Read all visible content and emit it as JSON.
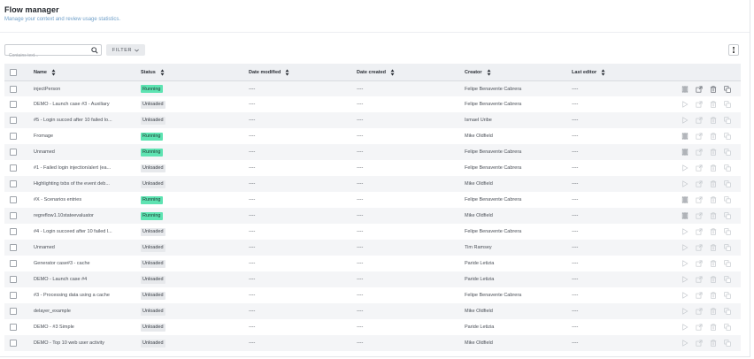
{
  "header": {
    "title": "Flow manager",
    "subtitle": "Manage your context and review usage statistics."
  },
  "toolbar": {
    "search_placeholder": "Contains text...",
    "filter_label": "FILTER"
  },
  "icons": {
    "search": "search-icon",
    "filter_chevron": "chevron-down-icon",
    "more": "more-vertical-icon",
    "sort": "sort-icon",
    "pause": "pause-icon",
    "play": "play-icon",
    "open": "open-external-icon",
    "delete": "trash-icon",
    "copy": "copy-icon"
  },
  "colors": {
    "running": "#5ee3b2",
    "unloaded": "#e7e9ec",
    "subtitle": "#6f9fc9",
    "header_bg": "#eef0f3",
    "alt_row_bg": "#f4f5f7"
  },
  "table": {
    "columns": [
      "Name",
      "Status",
      "Date modified",
      "Date created",
      "Creator",
      "Last editor"
    ],
    "rows": [
      {
        "name": "injectPerson",
        "status": "Running",
        "date_modified": "----",
        "date_created": "----",
        "creator": "Felipe Benavente Cabrera",
        "last_editor": "----"
      },
      {
        "name": "DEMO - Launch case #3 - Auxiliary",
        "status": "Unloaded",
        "date_modified": "----",
        "date_created": "----",
        "creator": "Felipe Benavente Cabrera",
        "last_editor": "----"
      },
      {
        "name": "#5 - Login succed after 10 failed lo...",
        "status": "Unloaded",
        "date_modified": "----",
        "date_created": "----",
        "creator": "Ismael Uribe",
        "last_editor": "----"
      },
      {
        "name": "Fromage",
        "status": "Running",
        "date_modified": "----",
        "date_created": "----",
        "creator": "Mike Oldfield",
        "last_editor": "----"
      },
      {
        "name": "Unnamed",
        "status": "Running",
        "date_modified": "----",
        "date_created": "----",
        "creator": "Felipe Benavente Cabrera",
        "last_editor": "----"
      },
      {
        "name": "#1 - Failed login injection/alert (ea...",
        "status": "Unloaded",
        "date_modified": "----",
        "date_created": "----",
        "creator": "Felipe Benavente Cabrera",
        "last_editor": "----"
      },
      {
        "name": "Highlighting txbs of the event deb...",
        "status": "Unloaded",
        "date_modified": "----",
        "date_created": "----",
        "creator": "Mike Oldfield",
        "last_editor": "----"
      },
      {
        "name": "#X - Scenarios entries",
        "status": "Running",
        "date_modified": "----",
        "date_created": "----",
        "creator": "Felipe Benavente Cabrera",
        "last_editor": "----"
      },
      {
        "name": "regreflow1.10stateevaluator",
        "status": "Running",
        "date_modified": "----",
        "date_created": "----",
        "creator": "Mike Oldfield",
        "last_editor": "----"
      },
      {
        "name": "#4 - Login succeed after 10 failed l...",
        "status": "Unloaded",
        "date_modified": "----",
        "date_created": "----",
        "creator": "Felipe Benavente Cabrera",
        "last_editor": "----"
      },
      {
        "name": "Unnamed",
        "status": "Unloaded",
        "date_modified": "----",
        "date_created": "----",
        "creator": "Tim Ramsey",
        "last_editor": "----"
      },
      {
        "name": "Generator case#3 - cache",
        "status": "Unloaded",
        "date_modified": "----",
        "date_created": "----",
        "creator": "Paride Letizia",
        "last_editor": "----"
      },
      {
        "name": "DEMO - Launch case #4",
        "status": "Unloaded",
        "date_modified": "----",
        "date_created": "----",
        "creator": "Paride Letizia",
        "last_editor": "----"
      },
      {
        "name": "#3 - Processing data using a cache",
        "status": "Unloaded",
        "date_modified": "----",
        "date_created": "----",
        "creator": "Felipe Benavente Cabrera",
        "last_editor": "----"
      },
      {
        "name": "delayer_example",
        "status": "Unloaded",
        "date_modified": "----",
        "date_created": "----",
        "creator": "Mike Oldfield",
        "last_editor": "----"
      },
      {
        "name": "DEMO - #3 Simple",
        "status": "Unloaded",
        "date_modified": "----",
        "date_created": "----",
        "creator": "Paride Letizia",
        "last_editor": "----"
      },
      {
        "name": "DEMO - Top 10 web user activity",
        "status": "Unloaded",
        "date_modified": "----",
        "date_created": "----",
        "creator": "Mike Oldfield",
        "last_editor": "----"
      }
    ]
  }
}
